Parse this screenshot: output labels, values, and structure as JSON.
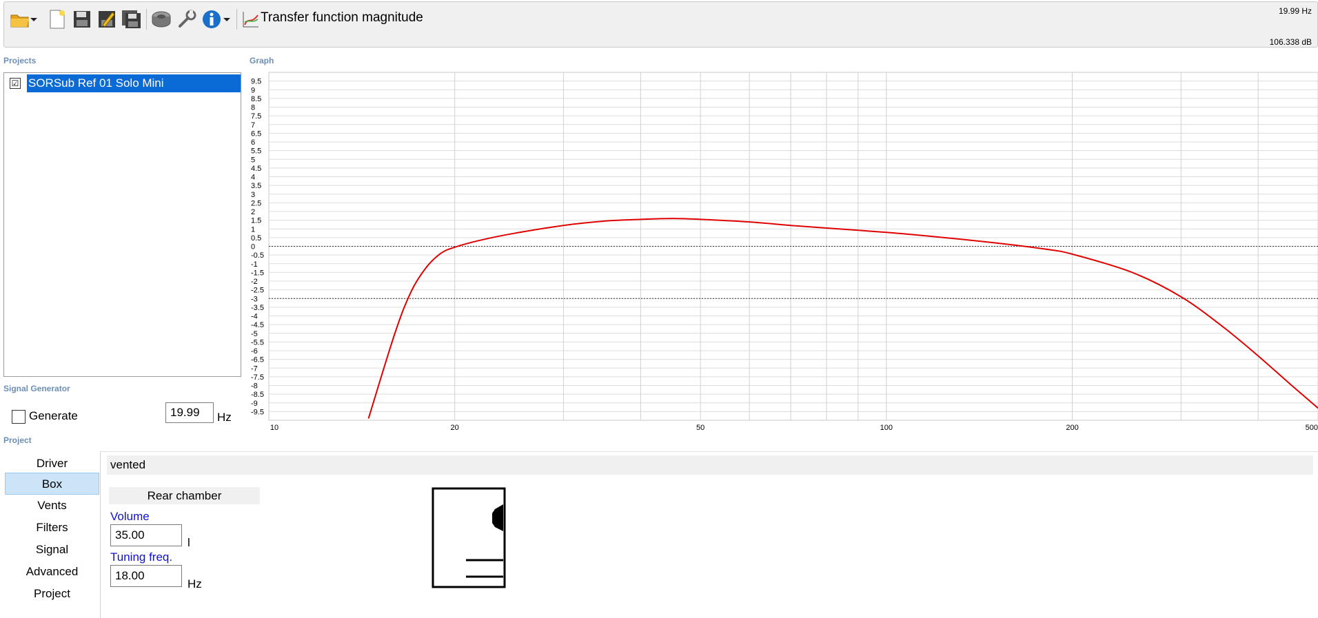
{
  "toolbar": {
    "title": "Transfer function magnitude",
    "icons": [
      "open-folder-icon",
      "new-file-icon",
      "save-icon",
      "save-as-icon",
      "save-all-icon",
      "speaker-icon",
      "wrench-icon",
      "info-icon",
      "chart-icon"
    ]
  },
  "readout": {
    "frequency": "19.99 Hz",
    "level": "106.338 dB"
  },
  "projects": {
    "heading": "Projects",
    "items": [
      {
        "label": "SORSub Ref 01 Solo Mini",
        "checked": true,
        "check_glyph": "☑"
      }
    ]
  },
  "graph": {
    "heading": "Graph"
  },
  "signal_generator": {
    "heading": "Signal Generator",
    "generate_label": "Generate",
    "frequency_value": "19.99",
    "unit": "Hz"
  },
  "project": {
    "heading": "Project",
    "nav": [
      "Driver",
      "Box",
      "Vents",
      "Filters",
      "Signal",
      "Advanced",
      "Project"
    ],
    "selected": "Box",
    "box_type": "vented",
    "rear_chamber": "Rear chamber",
    "volume": {
      "label": "Volume",
      "value": "35.00",
      "unit": "l"
    },
    "tuning": {
      "label": "Tuning freq.",
      "value": "18.00",
      "unit": "Hz"
    }
  },
  "colors": {
    "curve": "#e00000",
    "selection": "#0a6ad6",
    "heading": "#6d8fb5",
    "link": "#1010d0"
  },
  "chart_data": {
    "type": "line",
    "x_scale": "log",
    "xlim": [
      10,
      500
    ],
    "ylim": [
      -10,
      10
    ],
    "x_ticks": [
      "10",
      "20",
      "50",
      "100",
      "200",
      "500"
    ],
    "y_ticks": [
      "9.5",
      "9",
      "8.5",
      "8",
      "7.5",
      "7",
      "6.5",
      "6",
      "5.5",
      "5",
      "4.5",
      "4",
      "3.5",
      "3",
      "2.5",
      "2",
      "1.5",
      "1",
      "0.5",
      "0",
      "-0.5",
      "-1",
      "-1.5",
      "-2",
      "-2.5",
      "-3",
      "-3.5",
      "-4",
      "-4.5",
      "-5",
      "-5.5",
      "-6",
      "-6.5",
      "-7",
      "-7.5",
      "-8",
      "-8.5",
      "-9",
      "-9.5"
    ],
    "reference_lines": [
      0,
      -3
    ],
    "grid": true,
    "series": [
      {
        "x": [
          14.5,
          16,
          17,
          18,
          19,
          20,
          22,
          25,
          30,
          35,
          40,
          45,
          50,
          60,
          70,
          80,
          100,
          120,
          150,
          180,
          200,
          250,
          300,
          350,
          400,
          450,
          500
        ],
        "y": [
          -9.9,
          -5.0,
          -2.6,
          -1.2,
          -0.4,
          -0.05,
          0.35,
          0.75,
          1.2,
          1.45,
          1.55,
          1.6,
          1.55,
          1.4,
          1.2,
          1.05,
          0.8,
          0.55,
          0.2,
          -0.15,
          -0.45,
          -1.5,
          -2.9,
          -4.6,
          -6.3,
          -7.9,
          -9.3
        ]
      }
    ]
  }
}
